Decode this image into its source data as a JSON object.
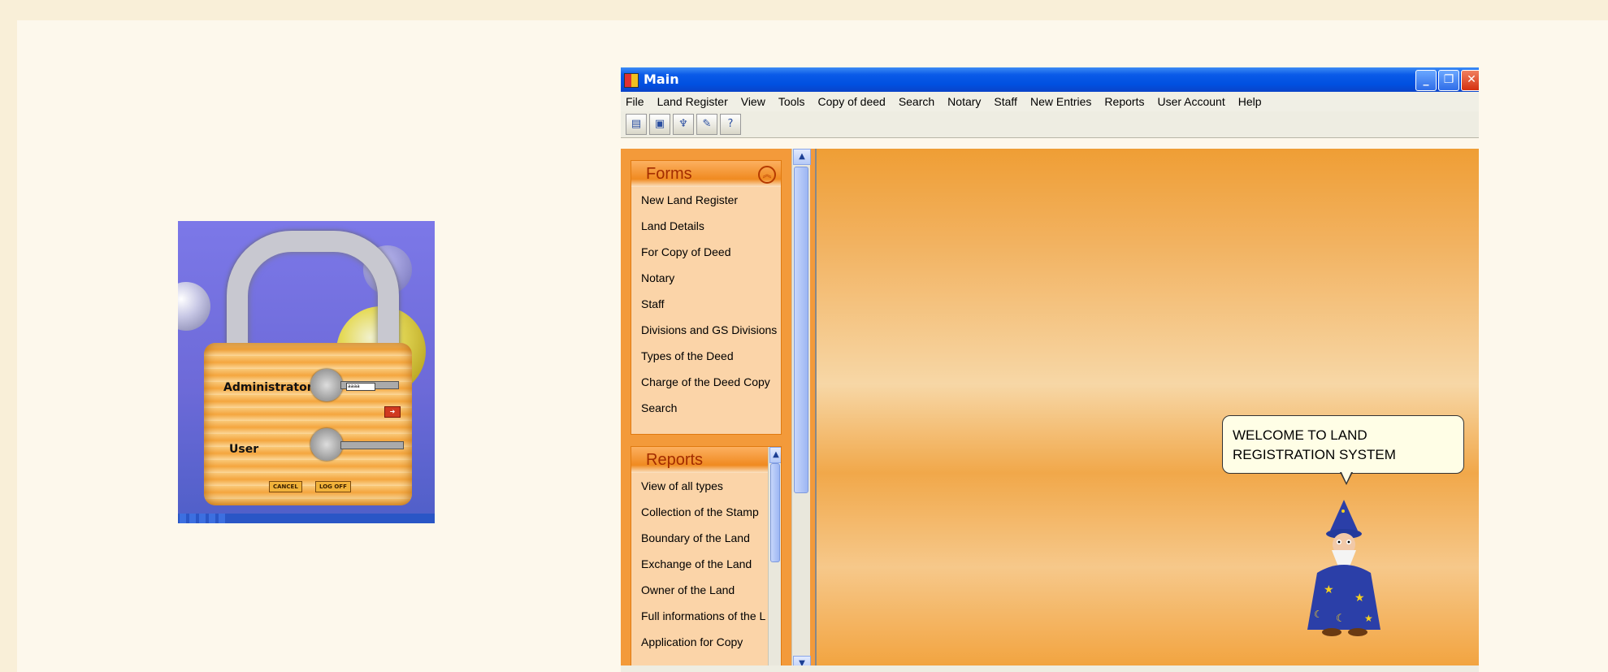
{
  "login": {
    "admin_label": "Administrator",
    "user_label": "User",
    "admin_input_value": "aaaa",
    "cancel_label": "CANCEL",
    "logoff_label": "LOG OFF"
  },
  "window": {
    "title": "Main",
    "buttons": {
      "minimize": "_",
      "restore": "❐",
      "close": "✕"
    }
  },
  "menu": [
    "File",
    "Land Register",
    "View",
    "Tools",
    "Copy of deed",
    "Search",
    "Notary",
    "Staff",
    "New Entries",
    "Reports",
    "User Account",
    "Help"
  ],
  "toolbar_icons": [
    "document-icon",
    "window-icon",
    "brush-icon",
    "note-icon",
    "help-icon"
  ],
  "forms": {
    "title": "Forms",
    "items": [
      "New Land Register",
      "Land Details",
      "For Copy of Deed",
      "Notary",
      "Staff",
      "Divisions and GS Divisions",
      "Types of the Deed",
      "Charge of the Deed Copy",
      "Search"
    ]
  },
  "reports": {
    "title": "Reports",
    "items": [
      "View of all types",
      "Collection of the Stamp",
      "Boundary of the Land",
      "Exchange of the Land",
      "Owner of the Land",
      "Full informations of the L",
      "Application for Copy"
    ]
  },
  "welcome": {
    "line1": "WELCOME TO LAND",
    "line2": "REGISTRATION SYSTEM"
  }
}
